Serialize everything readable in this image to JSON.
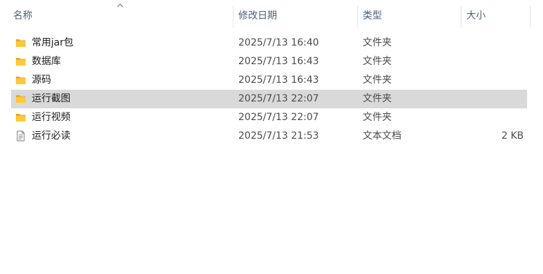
{
  "header": {
    "columns": {
      "name": "名称",
      "modified": "修改日期",
      "type": "类型",
      "size": "大小"
    },
    "sort_icon": "chevron-up-icon"
  },
  "files": [
    {
      "name": "常用jar包",
      "modified": "2025/7/13 16:40",
      "type": "文件夹",
      "size": "",
      "icon": "folder-icon"
    },
    {
      "name": "数据库",
      "modified": "2025/7/13 16:43",
      "type": "文件夹",
      "size": "",
      "icon": "folder-icon"
    },
    {
      "name": "源码",
      "modified": "2025/7/13 16:43",
      "type": "文件夹",
      "size": "",
      "icon": "folder-icon"
    },
    {
      "name": "运行截图",
      "modified": "2025/7/13 22:07",
      "type": "文件夹",
      "size": "",
      "icon": "folder-icon",
      "selected": true
    },
    {
      "name": "运行视频",
      "modified": "2025/7/13 22:07",
      "type": "文件夹",
      "size": "",
      "icon": "folder-icon"
    },
    {
      "name": "运行必读",
      "modified": "2025/7/13 21:53",
      "type": "文本文档",
      "size": "2 KB",
      "icon": "text-document-icon"
    }
  ],
  "colors": {
    "folder": "#ffc83d",
    "folder_back": "#e8a317",
    "selection": "#d9d9d9",
    "header_text": "#4c607a"
  }
}
